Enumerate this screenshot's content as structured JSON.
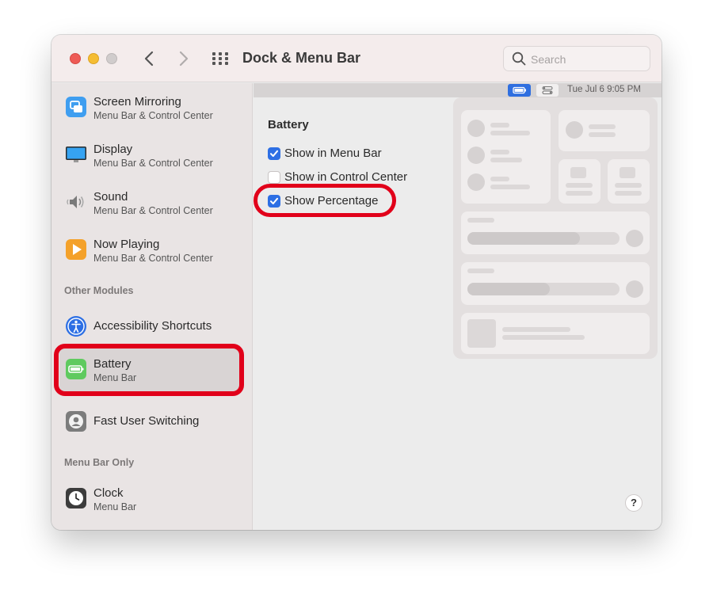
{
  "window": {
    "title": "Dock & Menu Bar"
  },
  "search": {
    "placeholder": "Search"
  },
  "menubar_preview": {
    "clock": "Tue Jul 6  9:05 PM"
  },
  "sidebar": {
    "items": [
      {
        "title": "Screen Mirroring",
        "subtitle": "Menu Bar & Control Center",
        "icon": "screen-mirroring-icon"
      },
      {
        "title": "Display",
        "subtitle": "Menu Bar & Control Center",
        "icon": "display-icon"
      },
      {
        "title": "Sound",
        "subtitle": "Menu Bar & Control Center",
        "icon": "sound-icon"
      },
      {
        "title": "Now Playing",
        "subtitle": "Menu Bar & Control Center",
        "icon": "now-playing-icon"
      }
    ],
    "other_modules_header": "Other Modules",
    "other_modules": [
      {
        "title": "Accessibility Shortcuts",
        "icon": "accessibility-icon"
      },
      {
        "title": "Battery",
        "subtitle": "Menu Bar",
        "icon": "battery-icon",
        "selected": true
      },
      {
        "title": "Fast User Switching",
        "icon": "user-switching-icon"
      }
    ],
    "menu_bar_only_header": "Menu Bar Only",
    "menu_bar_only": [
      {
        "title": "Clock",
        "subtitle": "Menu Bar",
        "icon": "clock-icon"
      }
    ]
  },
  "battery_settings": {
    "title": "Battery",
    "options": [
      {
        "label": "Show in Menu Bar",
        "checked": true
      },
      {
        "label": "Show in Control Center",
        "checked": false
      },
      {
        "label": "Show Percentage",
        "checked": true
      }
    ]
  },
  "help": {
    "label": "?"
  },
  "colors": {
    "accent": "#2d6fe4",
    "highlight": "#e1001a",
    "battery_green": "#5fca5f"
  }
}
